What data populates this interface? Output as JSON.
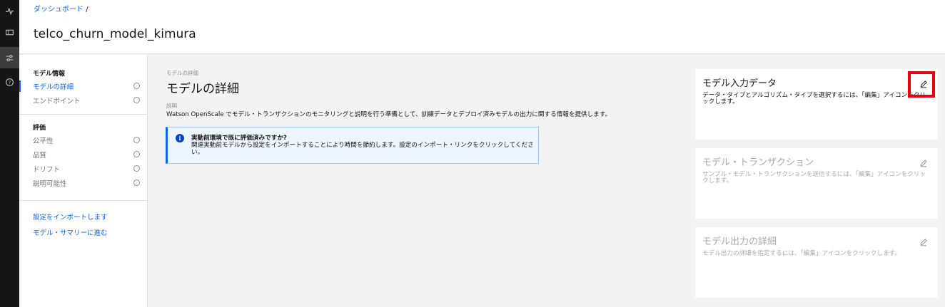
{
  "rail": {
    "icons": [
      "activity-icon",
      "ticket-icon",
      "settings-adjust-icon",
      "help-icon"
    ]
  },
  "header": {
    "breadcrumb_link": "ダッシュボード",
    "breadcrumb_sep": "/",
    "title": "telco_churn_model_kimura"
  },
  "sidebar": {
    "section_model": "モデル情報",
    "model_items": [
      {
        "label": "モデルの詳細",
        "active": true
      },
      {
        "label": "エンドポイント",
        "active": false
      }
    ],
    "section_eval": "評価",
    "eval_items": [
      {
        "label": "公平性"
      },
      {
        "label": "品質"
      },
      {
        "label": "ドリフト"
      },
      {
        "label": "説明可能性"
      }
    ],
    "links": [
      "設定をインポートします",
      "モデル・サマリーに進む"
    ]
  },
  "main": {
    "small_label": "モデルの詳細",
    "title": "モデルの詳細",
    "desc_label": "説明",
    "description": "Watson OpenScale でモデル・トランザクションのモニタリングと説明を行う準備として、訓練データとデプロイ済みモデルの出力に関する情報を提供します。",
    "notification": {
      "title": "実動前環境で既に評価済みですか?",
      "body": "関連実動前モデルから設定をインポートすることにより時間を節約します。設定のインポート・リンクをクリックしてください。"
    }
  },
  "cards": [
    {
      "title": "モデル入力データ",
      "description": "データ・タイプとアルゴリズム・タイプを選択するには、「編集」アイコンをクリックします。",
      "enabled": true
    },
    {
      "title": "モデル・トランザクション",
      "description": "サンプル・モデル・トランザクションを送信するには、「編集」アイコンをクリックします。",
      "enabled": false
    },
    {
      "title": "モデル出力の詳細",
      "description": "モデル出力の詳細を指定するには、「編集」アイコンをクリックします。",
      "enabled": false
    }
  ],
  "colors": {
    "accent": "#0f62fe",
    "highlight": "#e8000e",
    "rail": "#161616"
  }
}
